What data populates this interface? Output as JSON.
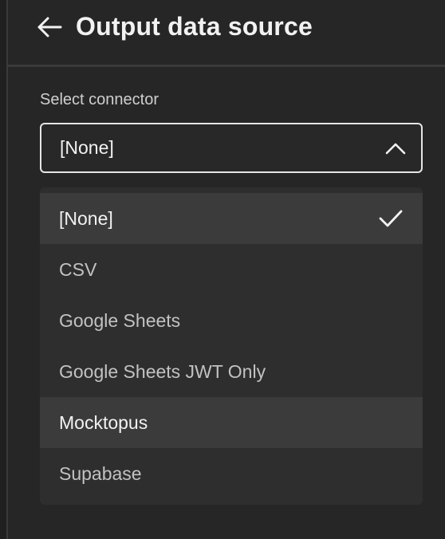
{
  "header": {
    "title": "Output data source",
    "back_icon": "arrow-left-icon"
  },
  "connector": {
    "label": "Select connector",
    "selected_value": "[None]",
    "chevron_icon": "chevron-up-icon",
    "options": [
      {
        "label": "[None]",
        "selected": true,
        "hovered": false
      },
      {
        "label": "CSV",
        "selected": false,
        "hovered": false
      },
      {
        "label": "Google Sheets",
        "selected": false,
        "hovered": false
      },
      {
        "label": "Google Sheets JWT Only",
        "selected": false,
        "hovered": false
      },
      {
        "label": "Mocktopus",
        "selected": false,
        "hovered": true
      },
      {
        "label": "Supabase",
        "selected": false,
        "hovered": false
      }
    ],
    "check_icon": "checkmark-icon"
  },
  "colors": {
    "background": "#262626",
    "menu_background": "#2e2e2e",
    "highlight": "#3b3b3b",
    "text_primary": "#f2f2f2",
    "text_secondary": "#c2c2c2"
  }
}
